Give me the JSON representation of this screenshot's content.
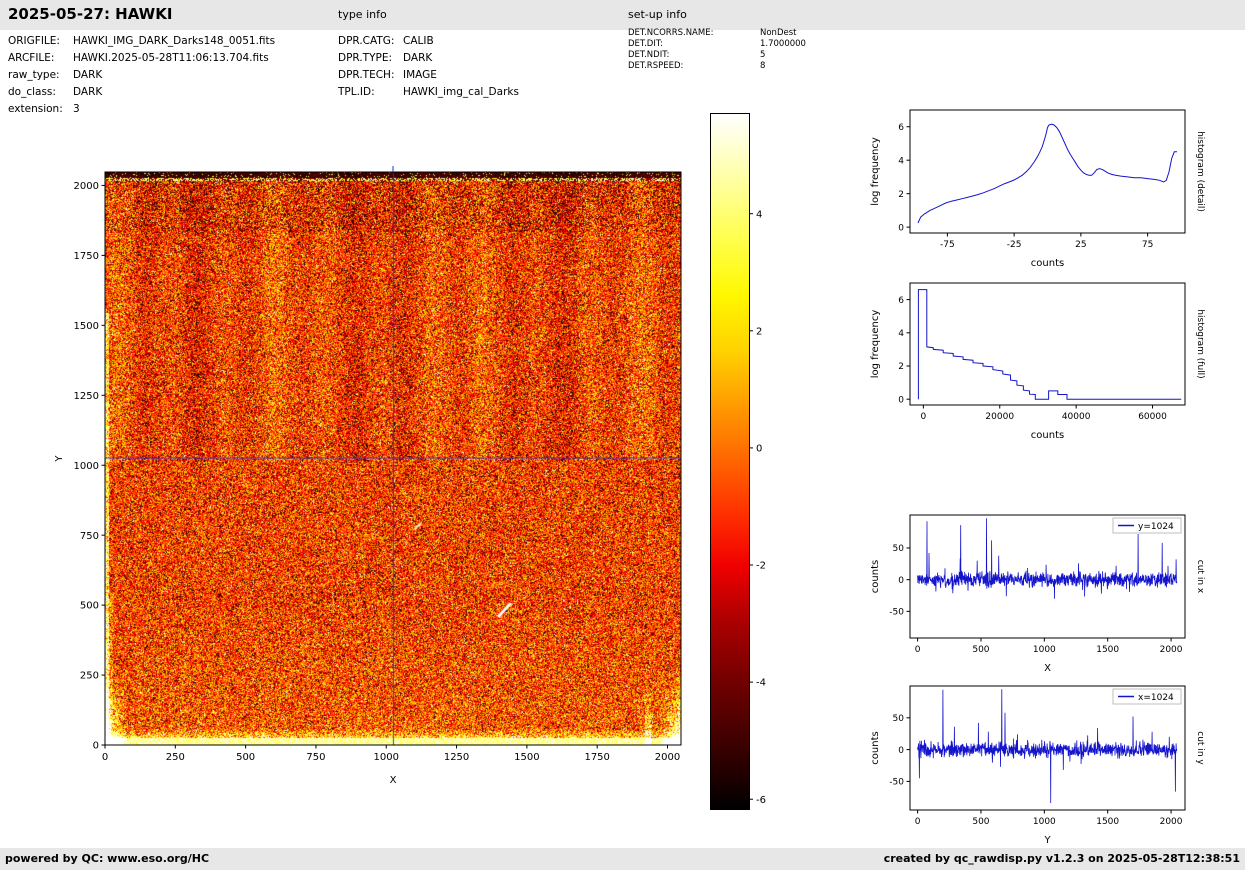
{
  "header": {
    "title": "2025-05-27: HAWKI",
    "type_info_label": "type info",
    "setup_info_label": "set-up info"
  },
  "file_info": {
    "rows": [
      {
        "label": "ORIGFILE:",
        "value": "HAWKI_IMG_DARK_Darks148_0051.fits"
      },
      {
        "label": "ARCFILE:",
        "value": "HAWKI.2025-05-28T11:06:13.704.fits"
      },
      {
        "label": "raw_type:",
        "value": "DARK"
      },
      {
        "label": "do_class:",
        "value": "DARK"
      },
      {
        "label": "extension:",
        "value": "3"
      }
    ]
  },
  "type_info": {
    "rows": [
      {
        "label": "DPR.CATG:",
        "value": "CALIB"
      },
      {
        "label": "DPR.TYPE:",
        "value": "DARK"
      },
      {
        "label": "DPR.TECH:",
        "value": "IMAGE"
      },
      {
        "label": "TPL.ID:",
        "value": "HAWKI_img_cal_Darks"
      }
    ]
  },
  "setup_info": {
    "rows": [
      {
        "label": "DET.NCORRS.NAME:",
        "value": "NonDest"
      },
      {
        "label": "DET.DIT:",
        "value": "1.7000000"
      },
      {
        "label": "DET.NDIT:",
        "value": "5"
      },
      {
        "label": "DET.RSPEED:",
        "value": "8"
      }
    ]
  },
  "footer": {
    "left": "powered by QC: www.eso.org/HC",
    "right": "created by qc_rawdisp.py v1.2.3 on 2025-05-28T12:38:51"
  },
  "chart_data": [
    {
      "id": "dark-frame-image",
      "type": "heatmap",
      "xlabel": "X",
      "ylabel": "Y",
      "xlim": [
        0,
        2048
      ],
      "ylim": [
        0,
        2048
      ],
      "xticks": [
        0,
        250,
        500,
        750,
        1000,
        1250,
        1500,
        1750,
        2000
      ],
      "yticks": [
        0,
        250,
        500,
        750,
        1000,
        1250,
        1500,
        1750,
        2000
      ],
      "crosshair_x": 1024,
      "crosshair_y": 1024,
      "crosshair_color": "#2d2dcd",
      "colormap": "hot",
      "colorbar": {
        "ticks": [
          4,
          2,
          0,
          -2,
          -4,
          -6
        ],
        "vmin": -6.15,
        "vmax": 5.72
      }
    },
    {
      "id": "histogram-detail",
      "type": "line",
      "xlabel": "counts",
      "ylabel": "log frequency",
      "side_label": "histogram (detail)",
      "xlim": [
        -103,
        103
      ],
      "ylim": [
        -0.35,
        7.0
      ],
      "xticks": [
        -75,
        -25,
        25,
        75
      ],
      "yticks": [
        0,
        2,
        4,
        6
      ],
      "line_color": "#1414cc",
      "points": [
        [
          -97,
          0.25
        ],
        [
          -95,
          0.6
        ],
        [
          -92,
          0.8
        ],
        [
          -88,
          1.0
        ],
        [
          -84,
          1.15
        ],
        [
          -80,
          1.3
        ],
        [
          -76,
          1.45
        ],
        [
          -72,
          1.55
        ],
        [
          -68,
          1.62
        ],
        [
          -64,
          1.7
        ],
        [
          -60,
          1.78
        ],
        [
          -56,
          1.86
        ],
        [
          -52,
          1.95
        ],
        [
          -48,
          2.05
        ],
        [
          -44,
          2.18
        ],
        [
          -40,
          2.3
        ],
        [
          -36,
          2.45
        ],
        [
          -32,
          2.6
        ],
        [
          -28,
          2.72
        ],
        [
          -25,
          2.82
        ],
        [
          -22,
          2.95
        ],
        [
          -19,
          3.1
        ],
        [
          -16,
          3.3
        ],
        [
          -13,
          3.55
        ],
        [
          -10,
          3.9
        ],
        [
          -8,
          4.15
        ],
        [
          -6,
          4.45
        ],
        [
          -4,
          4.8
        ],
        [
          -2,
          5.3
        ],
        [
          -1,
          5.6
        ],
        [
          0,
          5.95
        ],
        [
          1,
          6.1
        ],
        [
          3,
          6.15
        ],
        [
          5,
          6.1
        ],
        [
          7,
          5.95
        ],
        [
          9,
          5.7
        ],
        [
          11,
          5.35
        ],
        [
          13,
          5.0
        ],
        [
          15,
          4.65
        ],
        [
          17,
          4.35
        ],
        [
          19,
          4.1
        ],
        [
          21,
          3.85
        ],
        [
          23,
          3.6
        ],
        [
          25,
          3.4
        ],
        [
          27,
          3.25
        ],
        [
          29,
          3.15
        ],
        [
          31,
          3.1
        ],
        [
          33,
          3.1
        ],
        [
          35,
          3.25
        ],
        [
          37,
          3.45
        ],
        [
          39,
          3.5
        ],
        [
          41,
          3.45
        ],
        [
          43,
          3.35
        ],
        [
          45,
          3.25
        ],
        [
          48,
          3.15
        ],
        [
          51,
          3.1
        ],
        [
          55,
          3.05
        ],
        [
          60,
          3.0
        ],
        [
          65,
          2.95
        ],
        [
          70,
          2.95
        ],
        [
          75,
          2.9
        ],
        [
          80,
          2.85
        ],
        [
          84,
          2.8
        ],
        [
          87,
          2.7
        ],
        [
          89,
          2.8
        ],
        [
          91,
          3.3
        ],
        [
          93,
          4.1
        ],
        [
          95,
          4.5
        ],
        [
          97,
          4.5
        ]
      ]
    },
    {
      "id": "histogram-full",
      "type": "line",
      "xlabel": "counts",
      "ylabel": "log frequency",
      "side_label": "histogram (full)",
      "xlim": [
        -3500,
        68500
      ],
      "ylim": [
        -0.35,
        7.0
      ],
      "xticks": [
        0,
        20000,
        40000,
        60000
      ],
      "yticks": [
        0,
        2,
        4,
        6
      ],
      "line_color": "#1414cc",
      "points": [
        [
          -1300,
          0
        ],
        [
          -1300,
          6.6
        ],
        [
          900,
          6.6
        ],
        [
          900,
          3.15
        ],
        [
          2600,
          3.1
        ],
        [
          2600,
          3.0
        ],
        [
          5200,
          2.95
        ],
        [
          5200,
          2.8
        ],
        [
          7800,
          2.75
        ],
        [
          7800,
          2.6
        ],
        [
          10400,
          2.55
        ],
        [
          10400,
          2.4
        ],
        [
          13000,
          2.35
        ],
        [
          13000,
          2.2
        ],
        [
          15600,
          2.15
        ],
        [
          15600,
          2.0
        ],
        [
          18200,
          1.95
        ],
        [
          18200,
          1.78
        ],
        [
          20800,
          1.7
        ],
        [
          20800,
          1.52
        ],
        [
          22800,
          1.45
        ],
        [
          22800,
          1.15
        ],
        [
          24500,
          1.1
        ],
        [
          24500,
          0.85
        ],
        [
          26200,
          0.8
        ],
        [
          26200,
          0.55
        ],
        [
          27800,
          0.5
        ],
        [
          27800,
          0.3
        ],
        [
          29300,
          0.28
        ],
        [
          29300,
          0
        ],
        [
          32800,
          0
        ],
        [
          32800,
          0.5
        ],
        [
          35200,
          0.5
        ],
        [
          35200,
          0.28
        ],
        [
          37600,
          0.28
        ],
        [
          37600,
          0
        ],
        [
          67500,
          0
        ]
      ]
    },
    {
      "id": "cut-in-x",
      "type": "line",
      "xlabel": "X",
      "ylabel": "counts",
      "side_label": "cut in x",
      "legend": "y=1024",
      "xlim": [
        -60,
        2110
      ],
      "ylim": [
        -92,
        102
      ],
      "xticks": [
        0,
        500,
        1000,
        1500,
        2000
      ],
      "yticks": [
        -50,
        0,
        50
      ],
      "line_color": "#1414cc",
      "seed": 1234,
      "spikes": [
        [
          75,
          92
        ],
        [
          90,
          42
        ],
        [
          340,
          86
        ],
        [
          470,
          30
        ],
        [
          545,
          97
        ],
        [
          585,
          62
        ],
        [
          640,
          38
        ],
        [
          700,
          -26
        ],
        [
          1080,
          -30
        ],
        [
          1270,
          26
        ],
        [
          1450,
          -22
        ],
        [
          1740,
          72
        ],
        [
          1930,
          58
        ],
        [
          2040,
          32
        ]
      ]
    },
    {
      "id": "cut-in-y",
      "type": "line",
      "xlabel": "Y",
      "ylabel": "counts",
      "side_label": "cut in y",
      "legend": "x=1024",
      "xlim": [
        -60,
        2110
      ],
      "ylim": [
        -95,
        100
      ],
      "xticks": [
        0,
        500,
        1000,
        1500,
        2000
      ],
      "yticks": [
        -50,
        0,
        50
      ],
      "line_color": "#1414cc",
      "seed": 987,
      "spikes": [
        [
          15,
          -45
        ],
        [
          200,
          94
        ],
        [
          290,
          36
        ],
        [
          480,
          42
        ],
        [
          665,
          95
        ],
        [
          690,
          58
        ],
        [
          1050,
          -84
        ],
        [
          1150,
          -32
        ],
        [
          1420,
          34
        ],
        [
          1700,
          52
        ],
        [
          1850,
          28
        ],
        [
          2035,
          -66
        ]
      ]
    }
  ]
}
